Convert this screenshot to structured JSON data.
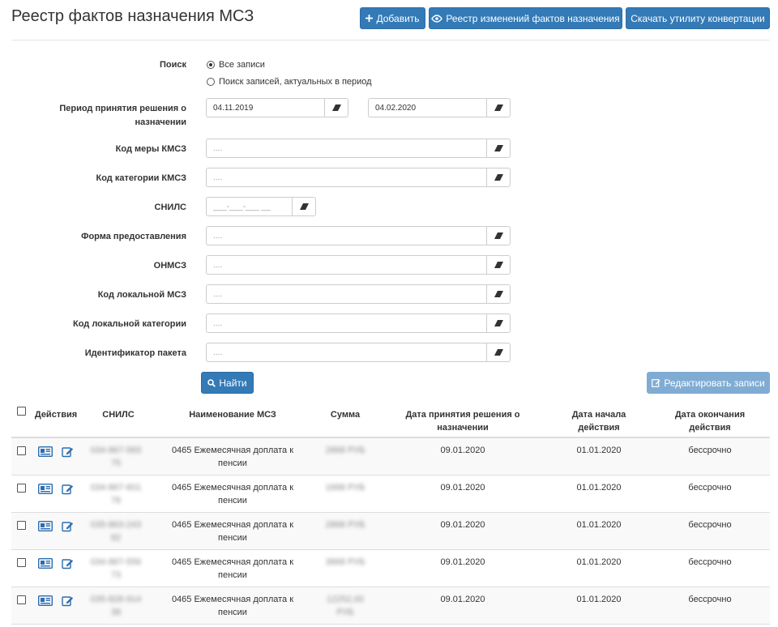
{
  "header": {
    "title": "Реестр фактов назначения МСЗ",
    "add_button": "Добавить",
    "changes_registry_button": "Реестр изменений фактов назначения",
    "download_button": "Скачать утилиту конвертации"
  },
  "search": {
    "label": "Поиск",
    "option_all": "Все записи",
    "option_period": "Поиск записей, актуальных в период"
  },
  "form": {
    "period_label": "Период принятия решения о назначении",
    "period_from": "04.11.2019",
    "period_to": "04.02.2020",
    "kmsz_label": "Код меры КМСЗ",
    "kmsz_cat_label": "Код категории КМСЗ",
    "snils_label": "СНИЛС",
    "snils_placeholder": "___-___-___ __",
    "form_label": "Форма предоставления",
    "onmsz_label": "ОНМСЗ",
    "local_msz_label": "Код локальной МСЗ",
    "local_cat_label": "Код локальной категории",
    "package_label": "Идентификатор пакета",
    "placeholder": "...."
  },
  "actions": {
    "find_button": "Найти",
    "edit_records_button": "Редактировать записи"
  },
  "table": {
    "headers": {
      "actions": "Действия",
      "snils": "СНИЛС",
      "msz_name": "Наименование МСЗ",
      "sum": "Сумма",
      "decision_date": "Дата принятия решения о назначении",
      "start_date": "Дата начала действия",
      "end_date": "Дата окончания действия"
    },
    "rows": [
      {
        "snils": "034-867-583 75",
        "msz": "0465 Ежемесячная доплата к пенсии",
        "sum": "2868 РУБ",
        "decision": "09.01.2020",
        "start": "01.01.2020",
        "end": "бессрочно"
      },
      {
        "snils": "034-867-601 76",
        "msz": "0465 Ежемесячная доплата к пенсии",
        "sum": "1668 РУБ",
        "decision": "09.01.2020",
        "start": "01.01.2020",
        "end": "бессрочно"
      },
      {
        "snils": "035-863-243 82",
        "msz": "0465 Ежемесячная доплата к пенсии",
        "sum": "2868 РУБ",
        "decision": "09.01.2020",
        "start": "01.01.2020",
        "end": "бессрочно"
      },
      {
        "snils": "034-867-556 73",
        "msz": "0465 Ежемесячная доплата к пенсии",
        "sum": "3868 РУБ",
        "decision": "09.01.2020",
        "start": "01.01.2020",
        "end": "бессрочно"
      },
      {
        "snils": "035-828-914 38",
        "msz": "0465 Ежемесячная доплата к пенсии",
        "sum": "12252,00 РУБ",
        "decision": "09.01.2020",
        "start": "01.01.2020",
        "end": "бессрочно"
      }
    ]
  },
  "colors": {
    "primary": "#337ab7",
    "primary_disabled": "#7aa8d1",
    "icon_blue": "#2a6db0"
  }
}
